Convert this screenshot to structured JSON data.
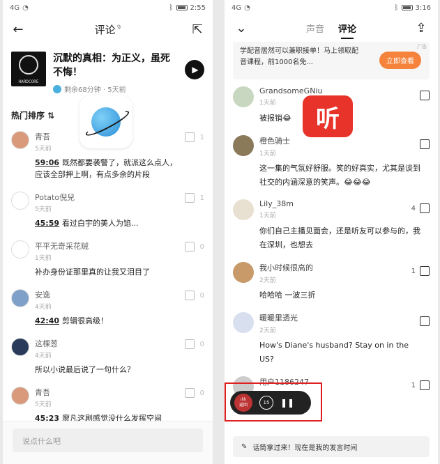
{
  "left": {
    "status": {
      "signal": "4G",
      "time": "2:55"
    },
    "header": {
      "title": "评论",
      "count": "9"
    },
    "book": {
      "title": "沉默的真相：为正义，虽死不悔！",
      "cover_text": "HARDCORE",
      "meta": "剩余68分钟 · 5天前"
    },
    "sort_label": "热门排序 ⇅",
    "comments": [
      {
        "name": "青吾",
        "time": "5天前",
        "ts": "59:06",
        "text": "既然都要袭警了，就派这么点人，应该全部押上啊，有点多余的片段",
        "likes": "1",
        "avatar_color": "#d89a7a"
      },
      {
        "name": "Potato倪兒",
        "time": "5天前",
        "ts": "45:59",
        "text": "看过白宇的美人为馅...",
        "likes": "1",
        "avatar_color": "#ffffff"
      },
      {
        "name": "平平无奇采花贼",
        "time": "1天前",
        "ts": "",
        "text": "补办身份证那里真的让我又泪目了",
        "likes": "0",
        "avatar_color": "#ffffff"
      },
      {
        "name": "安逸",
        "time": "4天前",
        "ts": "42:40",
        "text": "剪辑很高级！",
        "likes": "0",
        "avatar_color": "#7fa0c8"
      },
      {
        "name": "这棵葱",
        "time": "4天前",
        "ts": "",
        "text": "所以小说最后说了一句什么？",
        "likes": "0",
        "avatar_color": "#2a3a5a"
      },
      {
        "name": "青吾",
        "time": "5天前",
        "ts": "45:23",
        "text": "廖凡这剧感觉没什么发挥空间",
        "likes": "0",
        "avatar_color": "#d89a7a"
      }
    ],
    "input_placeholder": "说点什么吧"
  },
  "right": {
    "status": {
      "signal": "4G",
      "time": "3:16"
    },
    "tabs": [
      "声音",
      "评论"
    ],
    "active_tab": "评论",
    "ad": {
      "text": "学配音居然可以兼职接单！马上领取配音课程，前1000名免...",
      "button": "立即查看",
      "tag": "广告"
    },
    "logo_text": "听",
    "comments": [
      {
        "name": "GrandsomeGNiu",
        "time": "1天前",
        "text": "被报销😂",
        "likes": "",
        "avatar_color": "#c8d8c0"
      },
      {
        "name": "橙色骑士",
        "time": "1天前",
        "text": "这一集的气氛好舒服。笑的好真实，尤其是谈到社交的内涵深意的笑声。😂😂😂",
        "likes": "",
        "avatar_color": "#8a7a5a"
      },
      {
        "name": "Lily_38m",
        "time": "1天前",
        "text": "你们自己主播见面会，还是听友可以参与的，我在深圳，也想去",
        "likes": "4",
        "avatar_color": "#e8e0d0"
      },
      {
        "name": "我小时候很高的",
        "time": "2天前",
        "text": "哈哈哈 一波三折",
        "likes": "1",
        "avatar_color": "#c89a6a"
      },
      {
        "name": "暖暖里透光",
        "time": "2天前",
        "text": "How's Diane's husband? Stay on in the US?",
        "likes": "",
        "avatar_color": "#d8e0f0"
      },
      {
        "name": "用户1186247",
        "time": "",
        "text": "",
        "likes": "1",
        "avatar_color": "#cccccc"
      }
    ],
    "player": {
      "thumb_label": "返回",
      "rewind": "15",
      "pause": "❚❚"
    },
    "input_text": "话筒拿过来！现在是我的发言时间"
  }
}
